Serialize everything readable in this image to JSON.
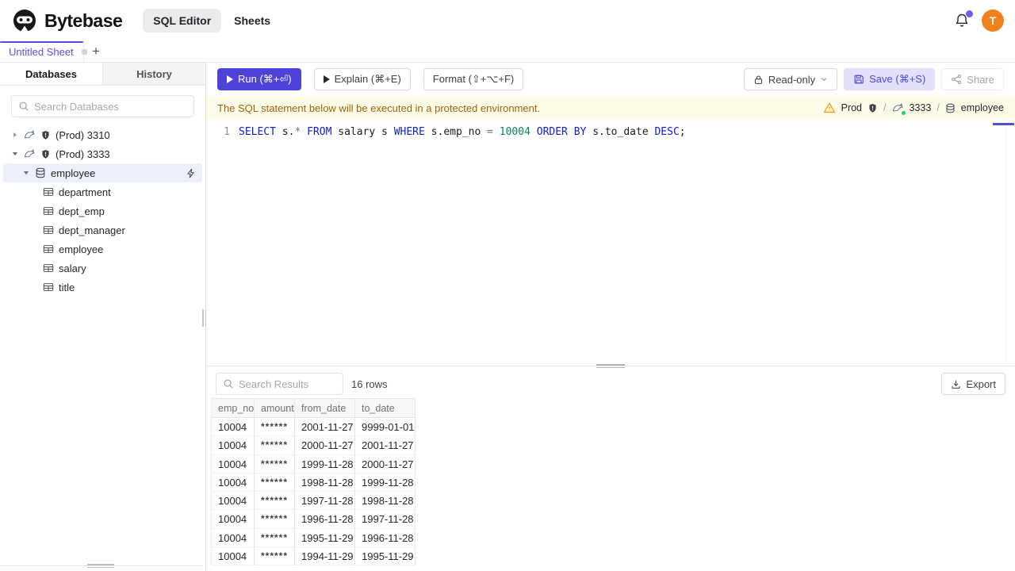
{
  "header": {
    "brand": "Bytebase",
    "nav": [
      {
        "label": "SQL Editor",
        "active": true
      },
      {
        "label": "Sheets",
        "active": false
      }
    ],
    "avatar_initial": "T"
  },
  "tabbar": {
    "tabs": [
      {
        "label": "Untitled Sheet",
        "active": true,
        "dirty": true
      }
    ],
    "new_tab": "+"
  },
  "sidebar": {
    "tabs": [
      {
        "label": "Databases",
        "active": true
      },
      {
        "label": "History",
        "active": false
      }
    ],
    "search_placeholder": "Search Databases",
    "instances": [
      {
        "label": "(Prod) 3310",
        "expanded": false
      },
      {
        "label": "(Prod) 3333",
        "expanded": true
      }
    ],
    "database": {
      "label": "employee",
      "selected": true
    },
    "tables": [
      "department",
      "dept_emp",
      "dept_manager",
      "employee",
      "salary",
      "title"
    ]
  },
  "toolbar": {
    "run": "Run (⌘+⏎)",
    "explain": "Explain (⌘+E)",
    "format": "Format (⇧+⌥+F)",
    "readonly": "Read-only",
    "save": "Save (⌘+S)",
    "share": "Share"
  },
  "banner": {
    "message": "The SQL statement below will be executed in a protected environment.",
    "environment": "Prod",
    "sep": "/",
    "instance": "3333",
    "database": "employee"
  },
  "editor": {
    "line_number": "1",
    "sql": "SELECT s.* FROM salary s WHERE s.emp_no = 10004 ORDER BY s.to_date DESC;",
    "tokens": [
      {
        "text": "SELECT",
        "cls": "kw"
      },
      {
        "text": " s.",
        "cls": "id"
      },
      {
        "text": "*",
        "cls": "op"
      },
      {
        "text": " ",
        "cls": "id"
      },
      {
        "text": "FROM",
        "cls": "kw"
      },
      {
        "text": " salary s ",
        "cls": "id"
      },
      {
        "text": "WHERE",
        "cls": "kw"
      },
      {
        "text": " s.emp_no ",
        "cls": "id"
      },
      {
        "text": "=",
        "cls": "op"
      },
      {
        "text": " ",
        "cls": "id"
      },
      {
        "text": "10004",
        "cls": "num"
      },
      {
        "text": " ",
        "cls": "id"
      },
      {
        "text": "ORDER",
        "cls": "kw"
      },
      {
        "text": " ",
        "cls": "id"
      },
      {
        "text": "BY",
        "cls": "kw"
      },
      {
        "text": " s.to_date ",
        "cls": "id"
      },
      {
        "text": "DESC",
        "cls": "kw"
      },
      {
        "text": ";",
        "cls": "id"
      }
    ]
  },
  "results": {
    "search_placeholder": "Search Results",
    "row_count": "16 rows",
    "export": "Export",
    "columns": [
      "emp_no",
      "amount",
      "from_date",
      "to_date"
    ],
    "rows": [
      [
        "10004",
        "******",
        "2001-11-27",
        "9999-01-01"
      ],
      [
        "10004",
        "******",
        "2000-11-27",
        "2001-11-27"
      ],
      [
        "10004",
        "******",
        "1999-11-28",
        "2000-11-27"
      ],
      [
        "10004",
        "******",
        "1998-11-28",
        "1999-11-28"
      ],
      [
        "10004",
        "******",
        "1997-11-28",
        "1998-11-28"
      ],
      [
        "10004",
        "******",
        "1996-11-28",
        "1997-11-28"
      ],
      [
        "10004",
        "******",
        "1995-11-29",
        "1996-11-28"
      ],
      [
        "10004",
        "******",
        "1994-11-29",
        "1995-11-29"
      ]
    ]
  },
  "colors": {
    "accent": "#4f46e5",
    "accent_light": "#e3e0fa",
    "banner_bg": "#fdfce9",
    "banner_text": "#a16207",
    "warning": "#f59e0b",
    "avatar_bg": "#f2811d",
    "notification_dot": "#6d5de8",
    "status_green": "#29c76f",
    "keyword_blue": "#0b1fd1",
    "number_green": "#098658",
    "selected_row_bg": "#edeffb"
  }
}
